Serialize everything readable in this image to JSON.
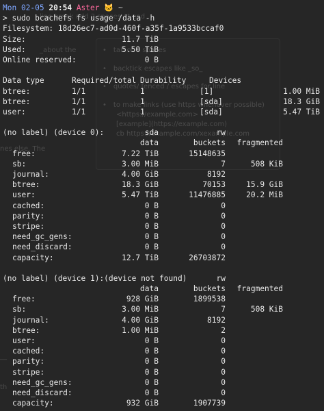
{
  "prompt": {
    "date": "Mon 02-05",
    "time": "20:54",
    "user": "Aster",
    "cat": "🐱",
    "path": "~",
    "command": "> sudo bcachefs fs usage /data -h"
  },
  "summary": [
    {
      "label": "Filesystem: 18d26ec7-ad0d-460f-a35f-1a9533bccaf0",
      "value": ""
    },
    {
      "label": "Size:",
      "value": "11.7 TiB"
    },
    {
      "label": "Used:",
      "value": "5.50 TiB"
    },
    {
      "label": "Online reserved:",
      "value": "0 B"
    }
  ],
  "replicas": {
    "headers": [
      "Data type",
      "Required/total",
      "Durability",
      "Devices"
    ],
    "rows": [
      [
        "btree:",
        "1/1",
        "1",
        "[1]",
        "1.00 MiB"
      ],
      [
        "btree:",
        "1/1",
        "1",
        "[sda]",
        "18.3 GiB"
      ],
      [
        "user:",
        "1/1",
        "1",
        "[sda]",
        "5.47 TiB"
      ]
    ]
  },
  "devices": [
    {
      "title": "(no label) (device 0):",
      "name": "sda",
      "state": "rw",
      "headers": [
        "data",
        "buckets",
        "fragmented"
      ],
      "rows": [
        [
          "free:",
          "7.22 TiB",
          "15148635",
          ""
        ],
        [
          "sb:",
          "3.00 MiB",
          "7",
          "508 KiB"
        ],
        [
          "journal:",
          "4.00 GiB",
          "8192",
          ""
        ],
        [
          "btree:",
          "18.3 GiB",
          "70153",
          "15.9 GiB"
        ],
        [
          "user:",
          "5.47 TiB",
          "11476885",
          "20.2 MiB"
        ],
        [
          "cached:",
          "0 B",
          "0",
          ""
        ],
        [
          "parity:",
          "0 B",
          "0",
          ""
        ],
        [
          "stripe:",
          "0 B",
          "0",
          ""
        ],
        [
          "need_gc_gens:",
          "0 B",
          "0",
          ""
        ],
        [
          "need_discard:",
          "0 B",
          "0",
          ""
        ],
        [
          "capacity:",
          "12.7 TiB",
          "26703872",
          ""
        ]
      ]
    },
    {
      "title": "(no label) (device 1):(device not found)",
      "name": "",
      "state": "rw",
      "headers": [
        "data",
        "buckets",
        "fragmented"
      ],
      "rows": [
        [
          "free:",
          "928 GiB",
          "1899538",
          ""
        ],
        [
          "sb:",
          "3.00 MiB",
          "7",
          "508 KiB"
        ],
        [
          "journal:",
          "4.00 GiB",
          "8192",
          ""
        ],
        [
          "btree:",
          "1.00 MiB",
          "2",
          ""
        ],
        [
          "user:",
          "0 B",
          "0",
          ""
        ],
        [
          "cached:",
          "0 B",
          "0",
          ""
        ],
        [
          "parity:",
          "0 B",
          "0",
          ""
        ],
        [
          "stripe:",
          "0 B",
          "0",
          ""
        ],
        [
          "need_gc_gens:",
          "0 B",
          "0",
          ""
        ],
        [
          "need_discard:",
          "0 B",
          "0",
          ""
        ],
        [
          "capacity:",
          "932 GiB",
          "1907739",
          ""
        ]
      ]
    }
  ]
}
